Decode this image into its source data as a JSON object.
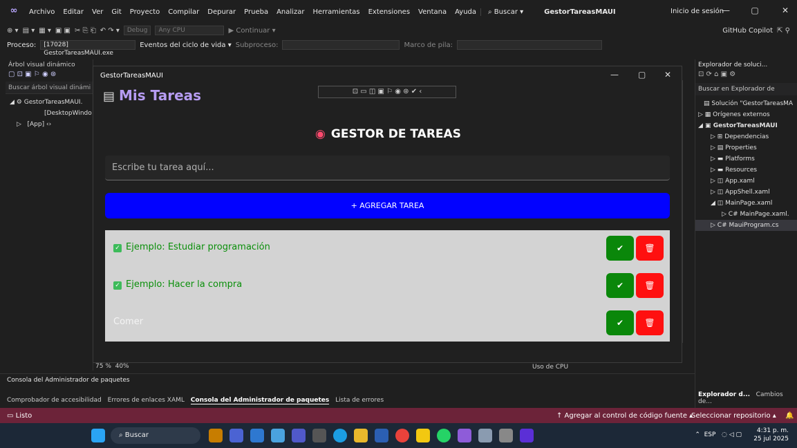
{
  "menu": {
    "items": [
      "Archivo",
      "Editar",
      "Ver",
      "Git",
      "Proyecto",
      "Compilar",
      "Depurar",
      "Prueba",
      "Analizar",
      "Herramientas",
      "Extensiones",
      "Ventana",
      "Ayuda"
    ],
    "search": "⌕ Buscar ▾",
    "project": "GestorTareasMAUI",
    "signin": "Inicio de sesión"
  },
  "toolbar": {
    "debug": "Debug",
    "cpu": "Any CPU",
    "continue": "▶ Continuar ▾",
    "copilot": "GitHub Copilot"
  },
  "process": {
    "label": "Proceso:",
    "value": "[17028] GestorTareasMAUI.exe",
    "lifecycle": "Eventos del ciclo de vida ▾",
    "subprocess": "Subproceso:",
    "stack": "Marco de pila:"
  },
  "left_panel": {
    "title": "Árbol visual dinámico",
    "search": "Buscar árbol visual dinámi",
    "tree": [
      "GestorTareasMAUI.",
      "[DesktopWindo",
      "[App]"
    ],
    "zoom": "75 %",
    "zoom2": "40%"
  },
  "right_panel": {
    "title": "Explorador de soluci...",
    "search": "Buscar en Explorador de",
    "tree": [
      "Solución \"GestorTareasMA",
      "Orígenes externos",
      "GestorTareasMAUI",
      "Dependencias",
      "Properties",
      "Platforms",
      "Resources",
      "App.xaml",
      "AppShell.xaml",
      "MainPage.xaml",
      "MainPage.xaml.",
      "MauiProgram.cs"
    ],
    "tab1": "Explorador d...",
    "tab2": "Cambios de..."
  },
  "bottom": {
    "title": "Consola del Administrador de paquetes",
    "tabs": [
      "Comprobador de accesibilidad",
      "Errores de enlaces XAML",
      "Consola del Administrador de paquetes",
      "Lista de errores"
    ],
    "cpu": "Uso de CPU"
  },
  "status": {
    "ready": "Listo",
    "git": "↑ Agregar al control de código fuente ▴",
    "repo": "Seleccionar repositorio ▴"
  },
  "taskbar": {
    "search": "Buscar",
    "lang": "ESP",
    "time": "4:31 p. m.",
    "date": "25 jul 2025"
  },
  "app": {
    "window_title": "GestorTareasMAUI",
    "header": "Mis Tareas",
    "heading": "GESTOR DE TAREAS",
    "input_placeholder": "Escribe tu tarea aquí...",
    "add_label": "+ AGREGAR TAREA",
    "tasks": [
      {
        "text": "Ejemplo: Estudiar programación",
        "done": true
      },
      {
        "text": "Ejemplo: Hacer la compra",
        "done": true
      },
      {
        "text": "Comer",
        "done": false
      }
    ],
    "colors": {
      "add": "#0202ff",
      "done": "#0a870a",
      "delete": "#ff1010",
      "done_text": "#0a8f0a",
      "list_bg": "#d3d3d3"
    }
  }
}
